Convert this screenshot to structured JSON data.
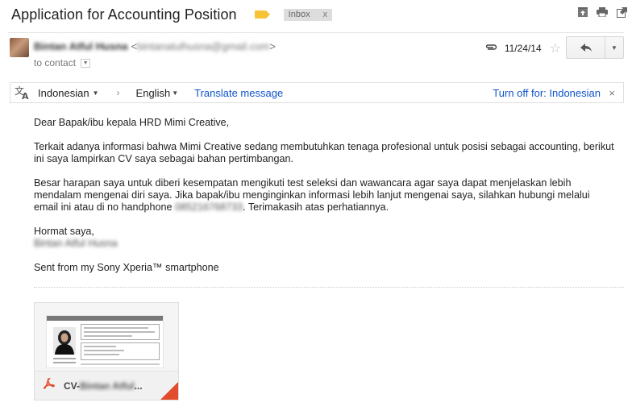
{
  "subject": "Application for Accounting Position",
  "label_color": "#f6c238",
  "inbox_chip": {
    "label": "Inbox",
    "close": "x"
  },
  "header_icons": [
    "pop-out-icon",
    "print-icon",
    "new-window-icon"
  ],
  "sender": {
    "name": "Bintan Atful Husna",
    "email": "bintanatulhusna@gmail.com",
    "lt": "<",
    "gt": ">",
    "to_line": "to contact"
  },
  "meta": {
    "date": "11/24/14"
  },
  "translate": {
    "from": "Indonesian",
    "to": "English",
    "arrow": "›",
    "translate_link": "Translate message",
    "turn_off": "Turn off for: Indonesian",
    "close": "×"
  },
  "body": {
    "greeting": "Dear Bapak/ibu kepala HRD Mimi Creative,",
    "p1": "Terkait adanya informasi bahwa Mimi Creative sedang membutuhkan tenaga profesional untuk posisi sebagai accounting, berikut ini saya lampirkan CV saya sebagai bahan pertimbangan.",
    "p2_a": "Besar harapan saya untuk diberi kesempatan mengikuti test seleksi dan wawancara agar saya dapat menjelaskan lebih mendalam mengenai diri saya. Jika bapak/ibu menginginkan informasi lebih lanjut mengenai saya, silahkan hubungi melalui email ini atau di no handphone ",
    "phone": "085216768733",
    "p2_b": ". Terimakasih atas perhatiannya.",
    "closing": "Hormat saya,",
    "signature": "Bintan Atful Husna",
    "footer": "Sent from my Sony Xperia™ smartphone"
  },
  "attachment": {
    "prefix": "CV-",
    "name_blurred": "Bintan Atful",
    "ellipsis": " ..."
  }
}
